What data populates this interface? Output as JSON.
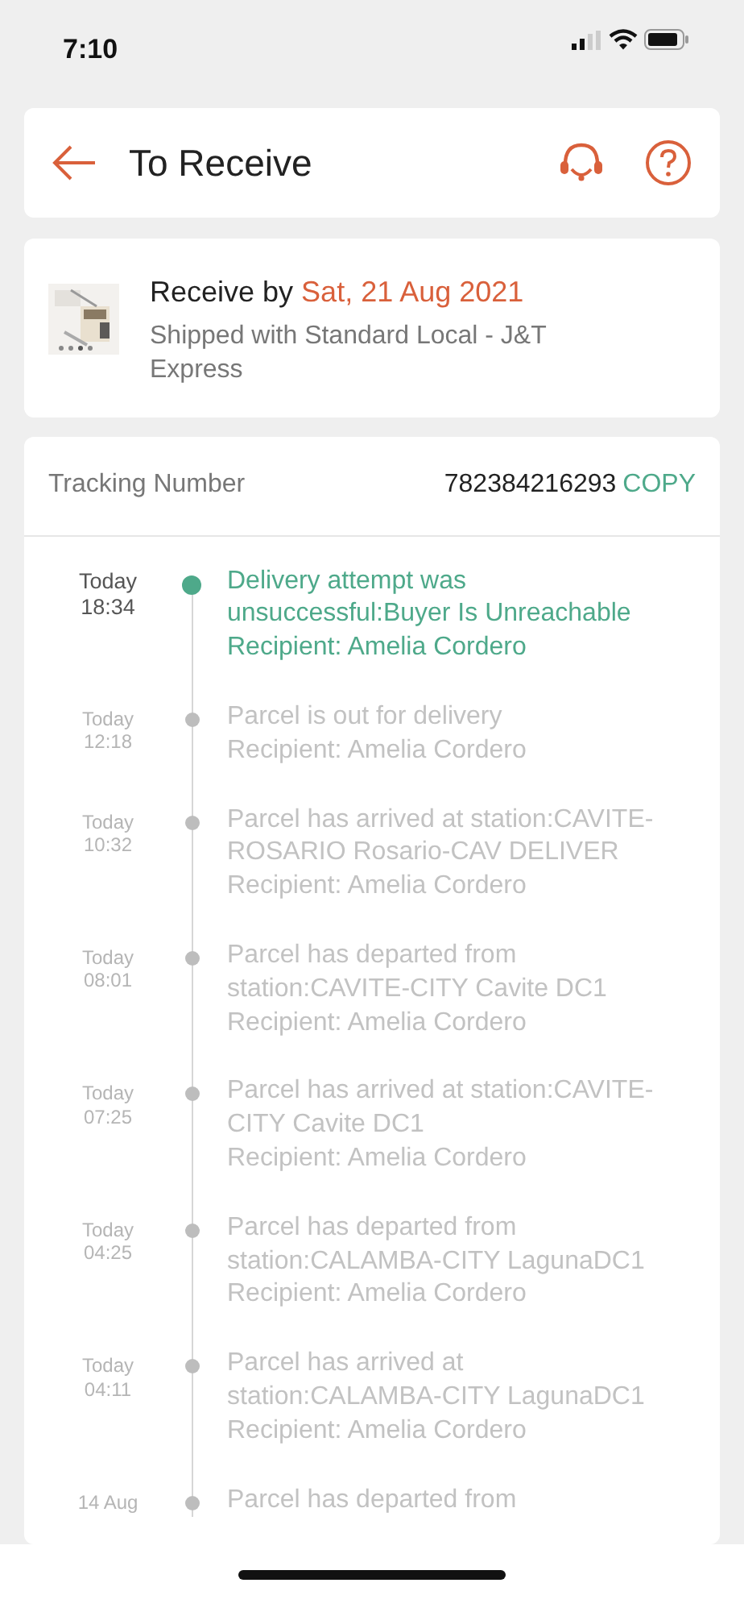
{
  "status_bar": {
    "time": "7:10"
  },
  "header": {
    "title": "To Receive"
  },
  "delivery": {
    "label": "Receive by",
    "date": "Sat, 21 Aug 2021",
    "shipping": "Shipped with Standard Local - J&T Express"
  },
  "tracking": {
    "label": "Tracking Number",
    "number": "782384216293",
    "copy": "COPY"
  },
  "events": [
    {
      "day": "Today",
      "time": "18:34",
      "text": "Delivery attempt was unsuccessful:Buyer Is Unreachable",
      "recipient": "Recipient: Amelia Cordero",
      "current": true
    },
    {
      "day": "Today",
      "time": "12:18",
      "text": "Parcel is out for delivery",
      "recipient": "Recipient: Amelia Cordero",
      "current": false
    },
    {
      "day": "Today",
      "time": "10:32",
      "text": "Parcel has arrived at station:CAVITE-ROSARIO Rosario-CAV DELIVER",
      "recipient": "Recipient: Amelia Cordero",
      "current": false
    },
    {
      "day": "Today",
      "time": "08:01",
      "text": "Parcel has departed from station:CAVITE-CITY Cavite DC1",
      "recipient": "Recipient: Amelia Cordero",
      "current": false
    },
    {
      "day": "Today",
      "time": "07:25",
      "text": "Parcel has arrived at station:CAVITE-CITY Cavite DC1",
      "recipient": "Recipient: Amelia Cordero",
      "current": false
    },
    {
      "day": "Today",
      "time": "04:25",
      "text": "Parcel has departed from station:CALAMBA-CITY LagunaDC1",
      "recipient": "Recipient: Amelia Cordero",
      "current": false
    },
    {
      "day": "Today",
      "time": "04:11",
      "text": "Parcel has arrived at station:CALAMBA-CITY LagunaDC1",
      "recipient": "Recipient: Amelia Cordero",
      "current": false
    },
    {
      "day": "14 Aug",
      "text": "Parcel has departed from",
      "current": false
    }
  ]
}
